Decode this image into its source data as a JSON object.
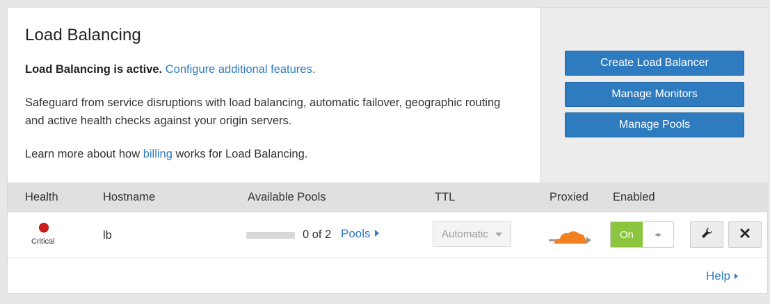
{
  "intro": {
    "title": "Load Balancing",
    "status_bold": "Load Balancing is active.",
    "status_link": "Configure additional features.",
    "description": "Safeguard from service disruptions with load balancing, automatic failover, geographic routing and active health checks against your origin servers.",
    "learn_prefix": "Learn more about how ",
    "learn_link": "billing",
    "learn_suffix": " works for Load Balancing."
  },
  "actions": {
    "create": "Create Load Balancer",
    "monitors": "Manage Monitors",
    "pools": "Manage Pools"
  },
  "table": {
    "headers": {
      "health": "Health",
      "hostname": "Hostname",
      "pools": "Available Pools",
      "ttl": "TTL",
      "proxied": "Proxied",
      "enabled": "Enabled"
    },
    "rows": [
      {
        "health": "Critical",
        "health_color": "#cf1d1d",
        "hostname": "lb",
        "pool_count": "0 of 2",
        "pools_link": "Pools",
        "ttl": "Automatic",
        "proxied_icon": "cloud-proxied-icon",
        "enabled_label": "On",
        "edit_icon": "wrench-icon",
        "delete_icon": "close-icon"
      }
    ]
  },
  "footer": {
    "help": "Help"
  },
  "colors": {
    "accent": "#2f7bbf",
    "toggle_on": "#8cc63f",
    "cloud": "#f38020",
    "critical": "#cf1d1d"
  }
}
